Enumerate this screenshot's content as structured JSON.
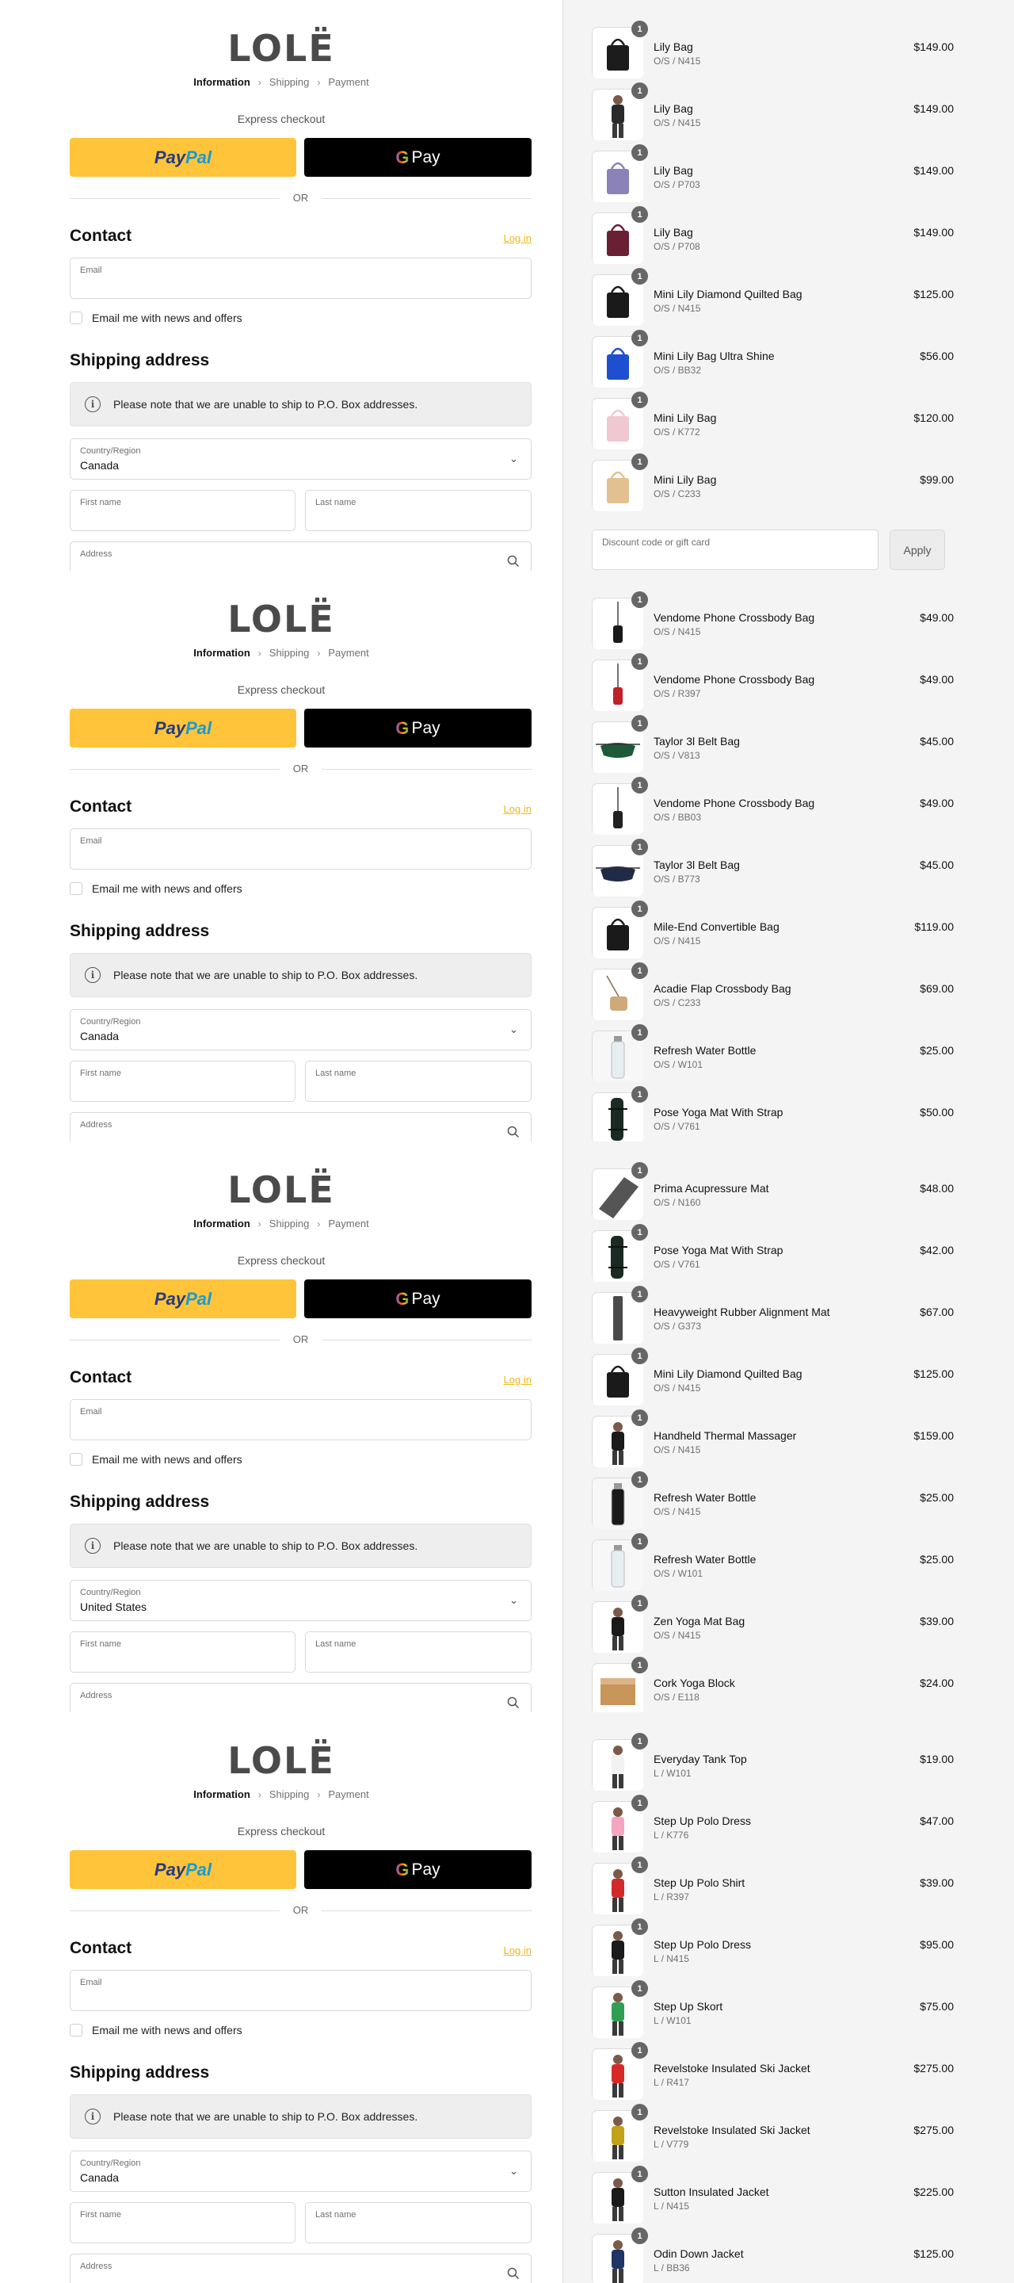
{
  "brand": {
    "logo": "LOLË"
  },
  "breadcrumb": {
    "step1": "Information",
    "step2": "Shipping",
    "step3": "Payment",
    "sep": "›"
  },
  "express": {
    "title": "Express checkout",
    "paypal_a": "Pay",
    "paypal_b": "Pal",
    "gpay_g": "G",
    "gpay_label": "Pay",
    "or": "OR"
  },
  "contact": {
    "title": "Contact",
    "login": "Log in",
    "email_label": "Email",
    "news_label": "Email me with news and offers"
  },
  "shipping": {
    "title": "Shipping address",
    "notice": "Please note that we are unable to ship to P.O. Box addresses.",
    "country_label": "Country/Region",
    "first_name": "First name",
    "last_name": "Last name",
    "address": "Address"
  },
  "discount": {
    "placeholder": "Discount code or gift card",
    "apply": "Apply"
  },
  "colors": {
    "accent": "#f0b71b",
    "paypal": "#ffc439",
    "summary_bg": "#f4f4f4"
  },
  "panels": [
    {
      "country": "Canada",
      "has_discount": true,
      "items": [
        {
          "name": "Lily Bag",
          "variant": "O/S / N415",
          "price": "$149.00",
          "qty": "1",
          "color": "#1c1c1c",
          "shape": "bag"
        },
        {
          "name": "Lily Bag",
          "variant": "O/S / N415",
          "price": "$149.00",
          "qty": "1",
          "color": "#2a2a2a",
          "shape": "person"
        },
        {
          "name": "Lily Bag",
          "variant": "O/S / P703",
          "price": "$149.00",
          "qty": "1",
          "color": "#8a82b8",
          "shape": "bag"
        },
        {
          "name": "Lily Bag",
          "variant": "O/S / P708",
          "price": "$149.00",
          "qty": "1",
          "color": "#6b1f34",
          "shape": "bag"
        },
        {
          "name": "Mini Lily Diamond Quilted Bag",
          "variant": "O/S / N415",
          "price": "$125.00",
          "qty": "1",
          "color": "#1a1a1a",
          "shape": "bag"
        },
        {
          "name": "Mini Lily Bag Ultra Shine",
          "variant": "O/S / BB32",
          "price": "$56.00",
          "qty": "1",
          "color": "#1f4fd1",
          "shape": "bag"
        },
        {
          "name": "Mini Lily Bag",
          "variant": "O/S / K772",
          "price": "$120.00",
          "qty": "1",
          "color": "#f1c7d0",
          "shape": "bag"
        },
        {
          "name": "Mini Lily Bag",
          "variant": "O/S / C233",
          "price": "$99.00",
          "qty": "1",
          "color": "#e3c08f",
          "shape": "bag"
        }
      ]
    },
    {
      "country": "Canada",
      "has_discount": false,
      "items": [
        {
          "name": "Vendome Phone Crossbody Bag",
          "variant": "O/S / N415",
          "price": "$49.00",
          "qty": "1",
          "color": "#1a1a1a",
          "shape": "phone"
        },
        {
          "name": "Vendome Phone Crossbody Bag",
          "variant": "O/S / R397",
          "price": "$49.00",
          "qty": "1",
          "color": "#c0212b",
          "shape": "phone"
        },
        {
          "name": "Taylor 3l Belt Bag",
          "variant": "O/S / V813",
          "price": "$45.00",
          "qty": "1",
          "color": "#1d5a3a",
          "shape": "belt"
        },
        {
          "name": "Vendome Phone Crossbody Bag",
          "variant": "O/S / BB03",
          "price": "$49.00",
          "qty": "1",
          "color": "#222",
          "shape": "phone"
        },
        {
          "name": "Taylor 3l Belt Bag",
          "variant": "O/S / B773",
          "price": "$45.00",
          "qty": "1",
          "color": "#1f2b48",
          "shape": "belt"
        },
        {
          "name": "Mile-End Convertible Bag",
          "variant": "O/S / N415",
          "price": "$119.00",
          "qty": "1",
          "color": "#1a1a1a",
          "shape": "bag"
        },
        {
          "name": "Acadie Flap Crossbody Bag",
          "variant": "O/S / C233",
          "price": "$69.00",
          "qty": "1",
          "color": "#cfa97a",
          "shape": "cross"
        },
        {
          "name": "Refresh Water Bottle",
          "variant": "O/S / W101",
          "price": "$25.00",
          "qty": "1",
          "color": "#e6eef2",
          "shape": "bottle"
        },
        {
          "name": "Pose Yoga Mat With Strap",
          "variant": "O/S / V761",
          "price": "$50.00",
          "qty": "1",
          "color": "#1b2a22",
          "shape": "mat"
        }
      ]
    },
    {
      "country": "United States",
      "has_discount": false,
      "items": [
        {
          "name": "Prima Acupressure Mat",
          "variant": "O/S / N160",
          "price": "$48.00",
          "qty": "1",
          "color": "#555",
          "shape": "flat"
        },
        {
          "name": "Pose Yoga Mat With Strap",
          "variant": "O/S / V761",
          "price": "$42.00",
          "qty": "1",
          "color": "#1b2a22",
          "shape": "mat"
        },
        {
          "name": "Heavyweight Rubber Alignment Mat",
          "variant": "O/S / G373",
          "price": "$67.00",
          "qty": "1",
          "color": "#4a4a4a",
          "shape": "roll"
        },
        {
          "name": "Mini Lily Diamond Quilted Bag",
          "variant": "O/S / N415",
          "price": "$125.00",
          "qty": "1",
          "color": "#1a1a1a",
          "shape": "bag"
        },
        {
          "name": "Handheld Thermal Massager",
          "variant": "O/S / N415",
          "price": "$159.00",
          "qty": "1",
          "color": "#1a1a1a",
          "shape": "person"
        },
        {
          "name": "Refresh Water Bottle",
          "variant": "O/S / N415",
          "price": "$25.00",
          "qty": "1",
          "color": "#1a1a1a",
          "shape": "bottle"
        },
        {
          "name": "Refresh Water Bottle",
          "variant": "O/S / W101",
          "price": "$25.00",
          "qty": "1",
          "color": "#e6eef2",
          "shape": "bottle"
        },
        {
          "name": "Zen Yoga Mat Bag",
          "variant": "O/S / N415",
          "price": "$39.00",
          "qty": "1",
          "color": "#1a1a1a",
          "shape": "person"
        },
        {
          "name": "Cork Yoga Block",
          "variant": "O/S / E118",
          "price": "$24.00",
          "qty": "1",
          "color": "#c8955a",
          "shape": "block"
        }
      ]
    },
    {
      "country": "Canada",
      "has_discount": false,
      "items": [
        {
          "name": "Everyday Tank Top",
          "variant": "L / W101",
          "price": "$19.00",
          "qty": "1",
          "color": "#f2f2f2",
          "shape": "person"
        },
        {
          "name": "Step Up Polo Dress",
          "variant": "L / K776",
          "price": "$47.00",
          "qty": "1",
          "color": "#f4a6c0",
          "shape": "person"
        },
        {
          "name": "Step Up Polo Shirt",
          "variant": "L / R397",
          "price": "$39.00",
          "qty": "1",
          "color": "#d22a2a",
          "shape": "person"
        },
        {
          "name": "Step Up Polo Dress",
          "variant": "L / N415",
          "price": "$95.00",
          "qty": "1",
          "color": "#1a1a1a",
          "shape": "person"
        },
        {
          "name": "Step Up Skort",
          "variant": "L / W101",
          "price": "$75.00",
          "qty": "1",
          "color": "#2f9e55",
          "shape": "person"
        },
        {
          "name": "Revelstoke Insulated Ski Jacket",
          "variant": "L / R417",
          "price": "$275.00",
          "qty": "1",
          "color": "#d72828",
          "shape": "person"
        },
        {
          "name": "Revelstoke Insulated Ski Jacket",
          "variant": "L / V779",
          "price": "$275.00",
          "qty": "1",
          "color": "#c3a21a",
          "shape": "person"
        },
        {
          "name": "Sutton Insulated Jacket",
          "variant": "L / N415",
          "price": "$225.00",
          "qty": "1",
          "color": "#1a1a1a",
          "shape": "person"
        },
        {
          "name": "Odin Down Jacket",
          "variant": "L / BB36",
          "price": "$125.00",
          "qty": "1",
          "color": "#1f3566",
          "shape": "person"
        }
      ]
    }
  ]
}
